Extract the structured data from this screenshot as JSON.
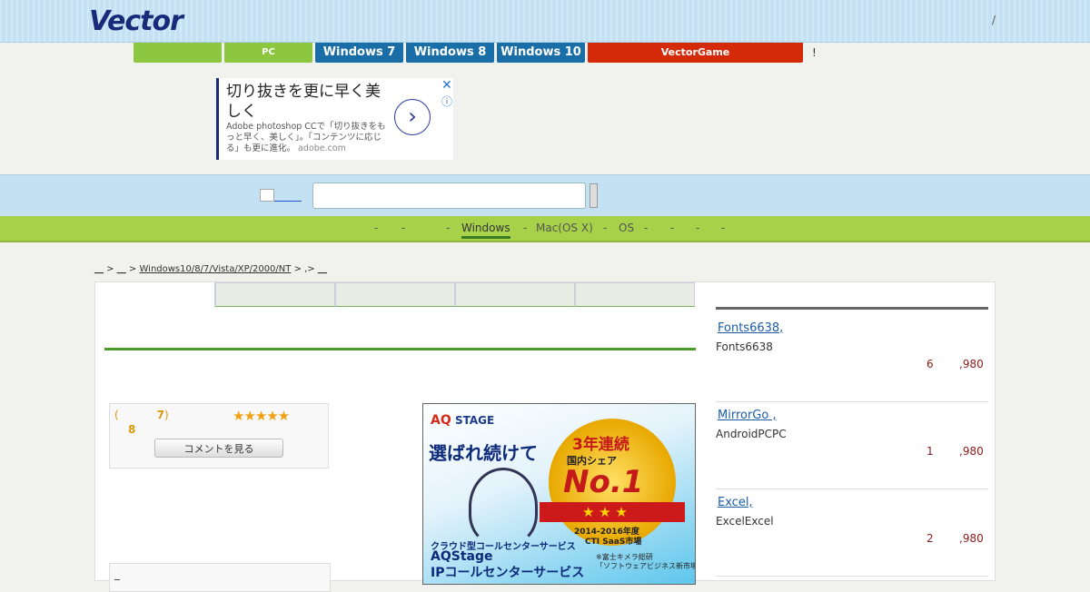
{
  "header": {
    "logo": "Vector",
    "right_text": "/"
  },
  "category_tabs": [
    {
      "label": "",
      "color": "#8dc63f"
    },
    {
      "label": "PC",
      "color": "#8dc63f"
    },
    {
      "label": "Windows 7",
      "color": "#1a6ea8"
    },
    {
      "label": "Windows 8",
      "color": "#1a6ea8"
    },
    {
      "label": "Windows 10",
      "color": "#1a6ea8"
    },
    {
      "label": "VectorGame",
      "color": "#d42a0a"
    }
  ],
  "category_tail": "!",
  "ad": {
    "headline": "切り抜きを更に早く美しく",
    "body": "Adobe photoshop CCで「切り抜きをもっと早く、美しく」。「コンテンツに応じる」も更に進化。",
    "domain": "adobe.com",
    "next": "›",
    "close": "✕",
    "info": "ⓘ"
  },
  "os_nav": {
    "items": [
      "-",
      "-",
      "-",
      "Windows",
      "-",
      "Mac(OS X)",
      "-",
      "OS",
      "-",
      "-",
      "-",
      "-"
    ],
    "active": "Windows"
  },
  "breadcrumb": {
    "part1": "__",
    "sep1": " > ",
    "part2": "__",
    "sep2": " > ",
    "part3": "Windows10/8/7/Vista/XP/2000/NT",
    "sep3": " > ,> ",
    "part4": "__"
  },
  "rating": {
    "paren_open": "(",
    "count": "7",
    "paren_close": ")",
    "score": "8",
    "stars": "★★★★★",
    "comment_button": "コメントを見る",
    "second_box": "_"
  },
  "big_ad": {
    "logo_a": "AQ",
    "logo_b": "STAGE",
    "headline": "選ばれ続けて",
    "badge_top": "3年連続",
    "badge_share": "国内シェア",
    "badge_no1": "No.1",
    "badge_stars": "★ ★ ★",
    "badge_year": "2014-2016年度",
    "badge_market": "CTI SaaS市場",
    "sub": "クラウド型コールセンターサービス",
    "name": "AQStage",
    "name2": "IPコールセンターサービス",
    "note": "※富士キメラ総研\n「ソフトウェアビジネス新市場」"
  },
  "sidebar": [
    {
      "title": "Fonts6638,",
      "desc": "Fonts6638",
      "num": "6",
      "price": ",980"
    },
    {
      "title": "MirrorGo ,",
      "desc": "AndroidPCPC",
      "num": "1",
      "price": ",980"
    },
    {
      "title": "Excel,",
      "desc": "ExcelExcel",
      "num": "2",
      "price": ",980"
    }
  ]
}
